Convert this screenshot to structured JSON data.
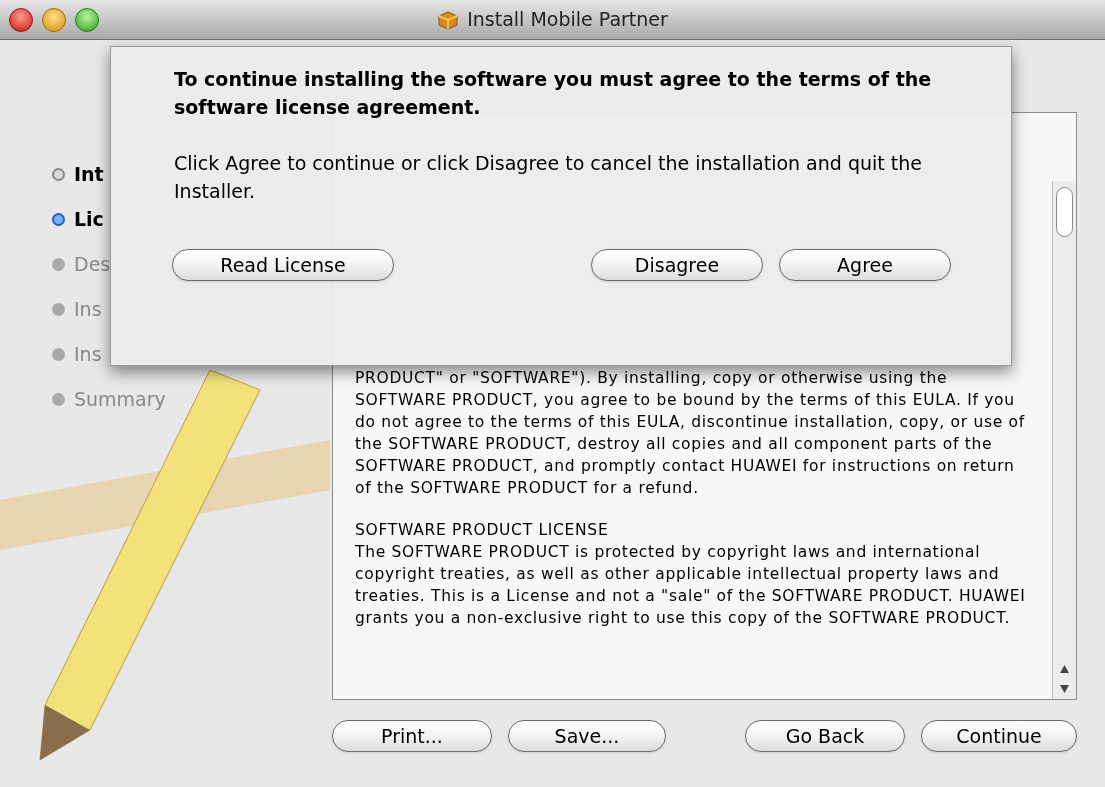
{
  "window": {
    "title": "Install Mobile Partner"
  },
  "sidebar": {
    "items": [
      {
        "label": "Int",
        "completed": true,
        "selected": false
      },
      {
        "label": "Lic",
        "completed": false,
        "selected": true
      },
      {
        "label": "Des",
        "completed": false,
        "selected": false
      },
      {
        "label": "Ins",
        "completed": false,
        "selected": false
      },
      {
        "label": "Ins",
        "completed": false,
        "selected": false
      },
      {
        "label": "Summary",
        "completed": false,
        "selected": false
      }
    ]
  },
  "license": {
    "paragraphs": [
      "PRODUCT\" or \"SOFTWARE\"). By installing, copy or otherwise using the SOFTWARE PRODUCT, you agree to be bound by the terms of this EULA. If you do not agree to the terms of this EULA, discontinue installation, copy, or use of the SOFTWARE PRODUCT, destroy all copies and all component parts of the SOFTWARE PRODUCT, and promptly contact HUAWEI for instructions on return of the SOFTWARE PRODUCT for a refund.",
      "SOFTWARE PRODUCT LICENSE\nThe SOFTWARE PRODUCT is protected by copyright laws and international copyright treaties, as well as other applicable intellectual property laws and treaties. This is a License and not a \"sale\" of the SOFTWARE PRODUCT. HUAWEI grants you a non-exclusive right to use this copy of the SOFTWARE PRODUCT."
    ]
  },
  "buttons": [
    "Print...",
    "Save...",
    "Go Back",
    "Continue"
  ],
  "sheet": {
    "heading": "To continue installing the software you must agree to the terms of the software license agreement.",
    "message": "Click Agree to continue or click Disagree to cancel the installation and quit the Installer.",
    "buttons": [
      "Read License",
      "Disagree",
      "Agree"
    ]
  }
}
